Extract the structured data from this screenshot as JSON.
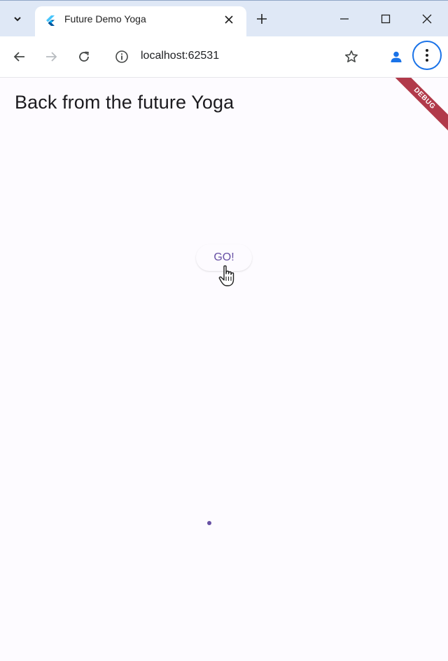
{
  "browser": {
    "tab": {
      "title": "Future Demo Yoga"
    },
    "address_bar": {
      "url": "localhost:62531"
    },
    "icons": {
      "tab_search": "chevron-down-icon",
      "favicon": "flutter-logo-icon",
      "tab_close": "close-icon",
      "new_tab": "plus-icon",
      "minimize": "minimize-icon",
      "maximize": "maximize-icon",
      "close_window": "close-icon",
      "back": "arrow-left-icon",
      "forward": "arrow-right-icon",
      "reload": "reload-icon",
      "site_info": "info-icon",
      "bookmark": "star-icon",
      "profile": "person-icon",
      "menu": "kebab-menu-icon"
    }
  },
  "app": {
    "title": "Back from the future Yoga",
    "debug_banner": "DEBUG",
    "go_button": "GO!"
  },
  "colors": {
    "accent": "#6750a4",
    "debug_banner": "#b13a4a",
    "focus_ring": "#1a73e8",
    "tabstrip": "#dfe8f6",
    "page_background": "#fdfbff"
  }
}
